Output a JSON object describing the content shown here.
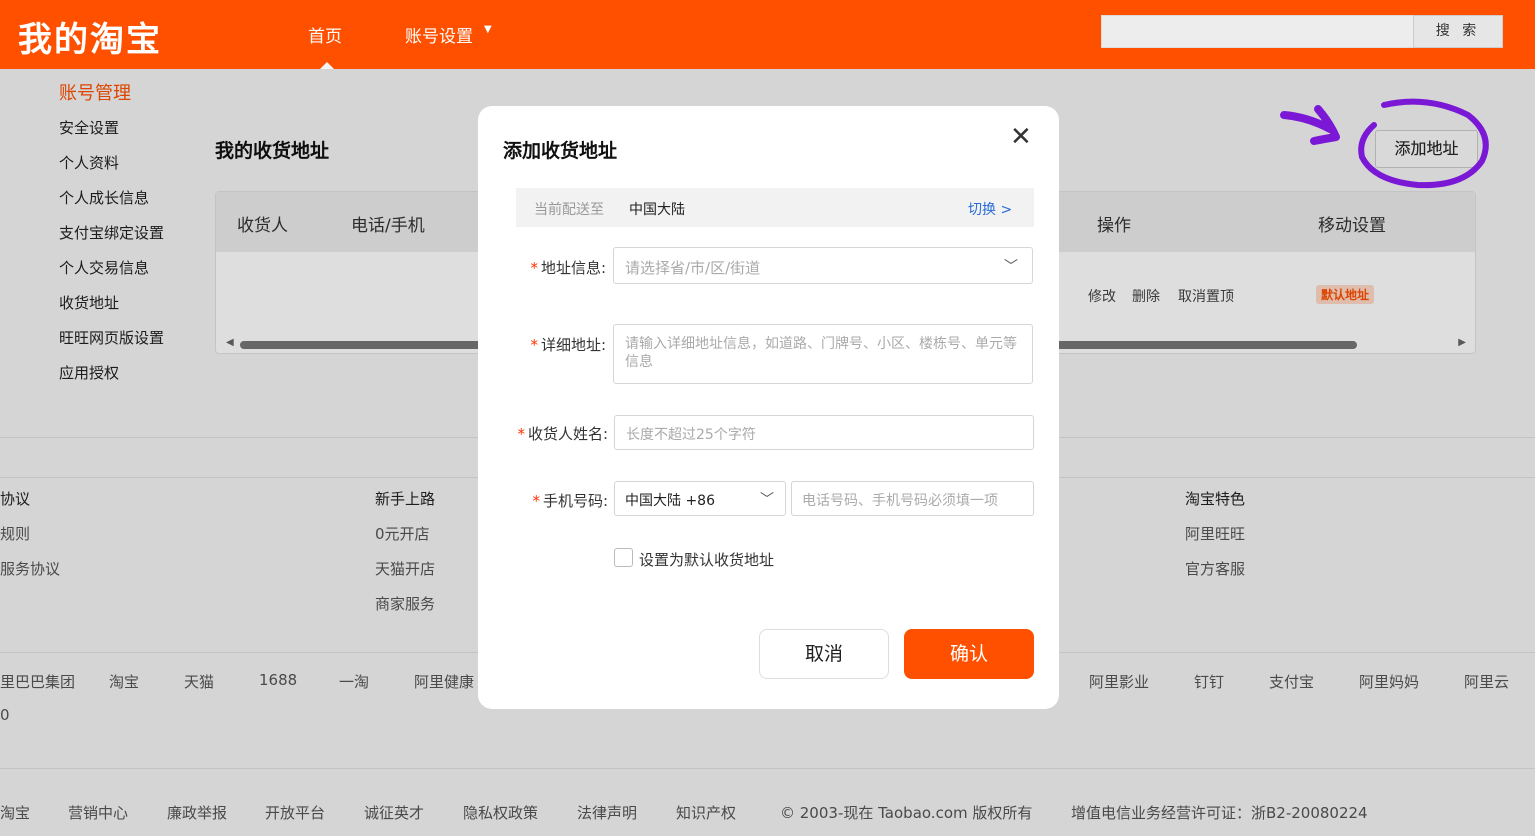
{
  "header": {
    "logo": "我的淘宝",
    "nav_home": "首页",
    "nav_settings": "账号设置",
    "search_button": "搜 索"
  },
  "sidebar": {
    "title": "账号管理",
    "items": [
      "安全设置",
      "个人资料",
      "个人成长信息",
      "支付宝绑定设置",
      "个人交易信息",
      "收货地址",
      "旺旺网页版设置",
      "应用授权"
    ]
  },
  "main": {
    "title": "我的收货地址",
    "add_button": "添加地址",
    "columns": [
      "收货人",
      "电话/手机",
      "操作",
      "移动设置"
    ],
    "row_actions": [
      "修改",
      "删除",
      "取消置顶"
    ],
    "default_badge": "默认地址"
  },
  "footer": {
    "col1_head": "协议",
    "col1_links": [
      "规则",
      "服务协议"
    ],
    "col2_head": "新手上路",
    "col2_links": [
      "0元开店",
      "天猫开店",
      "商家服务"
    ],
    "col3_head": "淘宝特色",
    "col3_links": [
      "阿里旺旺",
      "官方客服"
    ],
    "group_links": [
      "里巴巴集团",
      "淘宝",
      "天猫",
      "1688",
      "一淘",
      "阿里健康",
      "阿里影业",
      "钉钉",
      "支付宝",
      "阿里妈妈",
      "阿里云"
    ],
    "group_extra": "0",
    "bottom_links": [
      "淘宝",
      "营销中心",
      "廉政举报",
      "开放平台",
      "诚征英才",
      "隐私权政策",
      "法律声明",
      "知识产权",
      "© 2003-现在 Taobao.com 版权所有",
      "增值电信业务经营许可证：浙B2-20080224"
    ]
  },
  "modal": {
    "title": "添加收货地址",
    "close_icon": "close-icon",
    "region_label": "当前配送至",
    "region_value": "中国大陆",
    "region_switch": "切换 >",
    "address_label": "地址信息:",
    "address_placeholder": "请选择省/市/区/街道",
    "detail_label": "详细地址:",
    "detail_placeholder": "请输入详细地址信息，如道路、门牌号、小区、楼栋号、单元等信息",
    "name_label": "收货人姓名:",
    "name_placeholder": "长度不超过25个字符",
    "phone_label": "手机号码:",
    "phone_country": "中国大陆 +86",
    "phone_placeholder": "电话号码、手机号码必须填一项",
    "default_checkbox": "设置为默认收货地址",
    "cancel": "取消",
    "confirm": "确认",
    "required_mark": "*"
  },
  "colors": {
    "brand": "#ff5000",
    "annotation": "#7a18d6",
    "link": "#2a6bd6"
  }
}
